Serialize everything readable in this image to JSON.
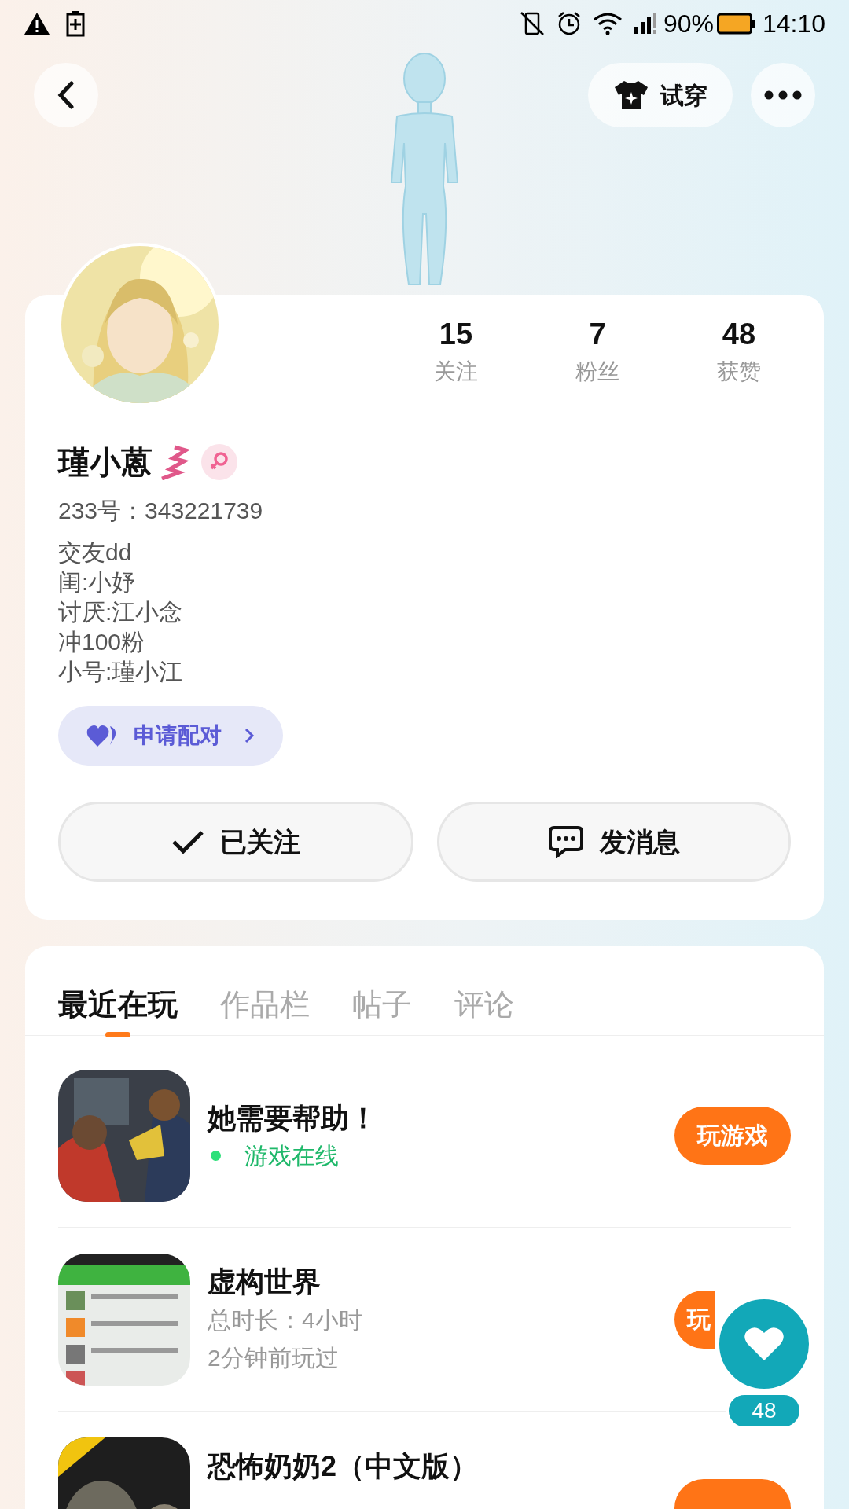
{
  "status_bar": {
    "battery": "90%",
    "time": "14:10"
  },
  "top_bar": {
    "try_on": "试穿"
  },
  "profile": {
    "stats": [
      {
        "value": "15",
        "label": "关注"
      },
      {
        "value": "7",
        "label": "粉丝"
      },
      {
        "value": "48",
        "label": "获赞"
      }
    ],
    "name": "瑾小蒽",
    "id": "233号：343221739",
    "bio": [
      "交友dd",
      "闺:小妤",
      "讨厌:江小念",
      "冲100粉",
      "小号:瑾小江"
    ],
    "match": "申请配对",
    "follow": "已关注",
    "message": "发消息"
  },
  "tabs": [
    {
      "label": "最近在玩",
      "selected": true
    },
    {
      "label": "作品栏",
      "selected": false
    },
    {
      "label": "帖子",
      "selected": false
    },
    {
      "label": "评论",
      "selected": false
    }
  ],
  "games": [
    {
      "title": "她需要帮助！",
      "status": "游戏在线",
      "button": "玩游戏"
    },
    {
      "title": "虚构世界",
      "lines": [
        "总时长：4小时",
        "2分钟前玩过"
      ],
      "button": "玩"
    },
    {
      "title": "恐怖奶奶2（中文版）"
    }
  ],
  "like_fab": {
    "count": "48"
  }
}
